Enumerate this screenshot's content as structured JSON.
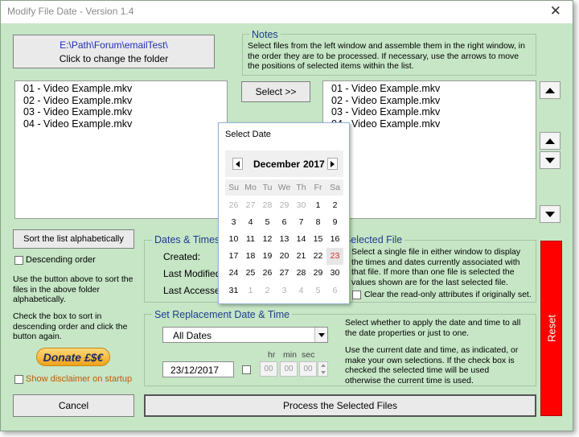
{
  "window": {
    "title": "Modify File Date - Version 1.4",
    "close": "✕"
  },
  "folder": {
    "path": "E:\\Path\\Forum\\emailTest\\",
    "hint": "Click to change the folder"
  },
  "notes": {
    "label": "Notes",
    "text": "Select files from the left window and assemble them in the right window, in the order they are to be processed. If necessary, use the arrows to move the positions of selected items within the list."
  },
  "select_button": "Select >>",
  "left_files": [
    "01 - Video Example.mkv",
    "02 - Video Example.mkv",
    "03 - Video Example.mkv",
    "04 - Video Example.mkv"
  ],
  "right_files": [
    "01 - Video Example.mkv",
    "02 - Video Example.mkv",
    "03 - Video Example.mkv",
    "04 - Video Example.mkv"
  ],
  "sort": {
    "button": "Sort the list alphabetically",
    "descending_label": "Descending order",
    "help1": "Use the button above to sort the files in the above folder alphabetically.",
    "help2": "Check the box to sort in descending order and click the button again."
  },
  "donate": {
    "label": "Donate £$€"
  },
  "disclaimer_label": "Show disclaimer on startup",
  "dates_group": {
    "label": "Dates & Times C",
    "created": "Created:",
    "modified": "Last Modified:",
    "accessed": "Last Accessed"
  },
  "selected_file": {
    "label": "Selected File",
    "text": "Select a single file in either window to display the times and dates currently associated with that file. If more than one file is selected the values shown are for the last selected file.",
    "clear_readonly": "Clear the read-only attributes if originally set."
  },
  "replacement": {
    "label": "Set Replacement Date & Time",
    "dropdown_value": "All Dates",
    "date_value": "23/12/2017",
    "hr_label": "hr",
    "min_label": "min",
    "sec_label": "sec",
    "hr": "00",
    "min": "00",
    "sec": "00",
    "help1": "Select whether to apply the date and time to all the date properties or just to one.",
    "help2": "Use the current date and time, as indicated, or make your own selections. If the check box is checked the selected time will be used otherwise the current time is used."
  },
  "cancel_button": "Cancel",
  "process_button": "Process the Selected Files",
  "reset_button": "Reset",
  "calendar": {
    "title": "Select Date",
    "month": "December",
    "year": "2017",
    "weekdays": [
      "Su",
      "Mo",
      "Tu",
      "We",
      "Th",
      "Fr",
      "Sa"
    ],
    "days": [
      {
        "d": "26",
        "muted": true
      },
      {
        "d": "27",
        "muted": true
      },
      {
        "d": "28",
        "muted": true
      },
      {
        "d": "29",
        "muted": true
      },
      {
        "d": "30",
        "muted": true
      },
      {
        "d": "1"
      },
      {
        "d": "2"
      },
      {
        "d": "3"
      },
      {
        "d": "4"
      },
      {
        "d": "5"
      },
      {
        "d": "6"
      },
      {
        "d": "7"
      },
      {
        "d": "8"
      },
      {
        "d": "9"
      },
      {
        "d": "10"
      },
      {
        "d": "11"
      },
      {
        "d": "12"
      },
      {
        "d": "13"
      },
      {
        "d": "14"
      },
      {
        "d": "15"
      },
      {
        "d": "16"
      },
      {
        "d": "17"
      },
      {
        "d": "18"
      },
      {
        "d": "19"
      },
      {
        "d": "20"
      },
      {
        "d": "21"
      },
      {
        "d": "22"
      },
      {
        "d": "23",
        "selected": true
      },
      {
        "d": "24"
      },
      {
        "d": "25"
      },
      {
        "d": "26"
      },
      {
        "d": "27"
      },
      {
        "d": "28"
      },
      {
        "d": "29"
      },
      {
        "d": "30"
      },
      {
        "d": "31"
      },
      {
        "d": "1",
        "muted": true
      },
      {
        "d": "2",
        "muted": true
      },
      {
        "d": "3",
        "muted": true
      },
      {
        "d": "4",
        "muted": true
      },
      {
        "d": "5",
        "muted": true
      },
      {
        "d": "6",
        "muted": true
      }
    ]
  },
  "colors": {
    "background": "#c6e6c6",
    "label_blue": "#1f3c8f",
    "reset_red": "#ff0000",
    "disclaimer_orange": "#c25a00"
  }
}
